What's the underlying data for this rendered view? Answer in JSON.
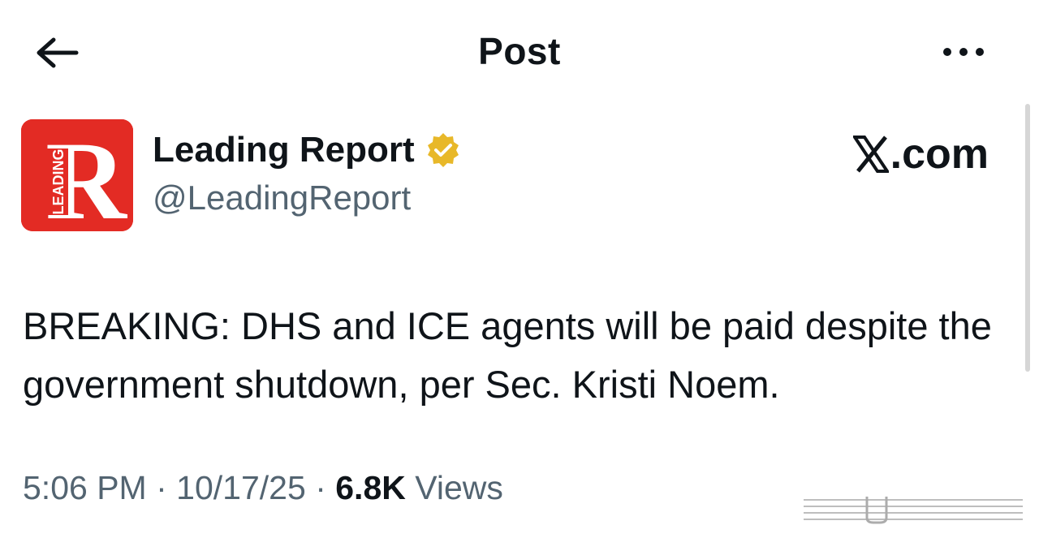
{
  "header": {
    "title": "Post",
    "back_icon": "arrow-left-icon",
    "more_icon": "more-horizontal-icon"
  },
  "author": {
    "display_name": "Leading Report",
    "handle": "@LeadingReport",
    "verified": true,
    "verified_color": "#e8b829",
    "avatar_letter": "R",
    "avatar_text": "LEADING",
    "avatar_color": "#e32b24"
  },
  "brand": {
    "label": ".com",
    "icon": "x-logo-icon"
  },
  "post": {
    "text": "BREAKING: DHS and ICE agents will be paid despite the government shutdown, per Sec. Kristi Noem."
  },
  "meta": {
    "time": "5:06 PM",
    "separator": "·",
    "date": "10/17/25",
    "views_count": "6.8K",
    "views_label": "Views"
  },
  "colors": {
    "text_primary": "#0f1419",
    "text_secondary": "#536471"
  }
}
